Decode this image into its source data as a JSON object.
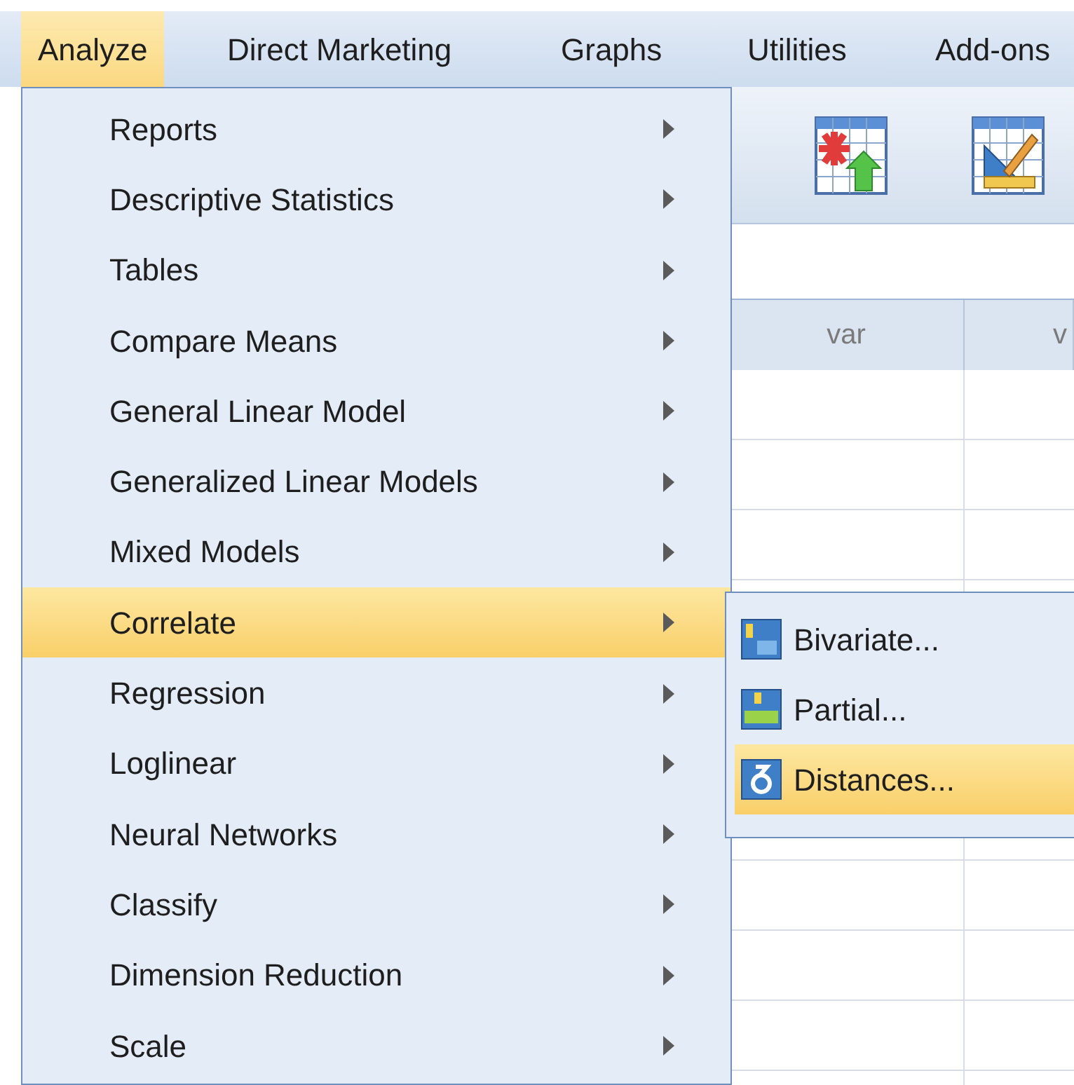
{
  "menu_bar": [
    {
      "label": "Analyze",
      "selected": true
    },
    {
      "label": "Direct Marketing",
      "selected": false
    },
    {
      "label": "Graphs",
      "selected": false
    },
    {
      "label": "Utilities",
      "selected": false
    },
    {
      "label": "Add-ons",
      "selected": false
    }
  ],
  "analyze_menu": {
    "items": [
      {
        "label": "Reports",
        "submenu": true,
        "selected": false
      },
      {
        "label": "Descriptive Statistics",
        "submenu": true,
        "selected": false
      },
      {
        "label": "Tables",
        "submenu": true,
        "selected": false
      },
      {
        "label": "Compare Means",
        "submenu": true,
        "selected": false
      },
      {
        "label": "General Linear Model",
        "submenu": true,
        "selected": false
      },
      {
        "label": "Generalized Linear Models",
        "submenu": true,
        "selected": false
      },
      {
        "label": "Mixed Models",
        "submenu": true,
        "selected": false
      },
      {
        "label": "Correlate",
        "submenu": true,
        "selected": true
      },
      {
        "label": "Regression",
        "submenu": true,
        "selected": false
      },
      {
        "label": "Loglinear",
        "submenu": true,
        "selected": false
      },
      {
        "label": "Neural Networks",
        "submenu": true,
        "selected": false
      },
      {
        "label": "Classify",
        "submenu": true,
        "selected": false
      },
      {
        "label": "Dimension Reduction",
        "submenu": true,
        "selected": false
      },
      {
        "label": "Scale",
        "submenu": true,
        "selected": false
      }
    ]
  },
  "correlate_submenu": {
    "items": [
      {
        "label": "Bivariate...",
        "kind": "bivariate",
        "selected": false
      },
      {
        "label": "Partial...",
        "kind": "partial",
        "selected": false
      },
      {
        "label": "Distances...",
        "kind": "distances",
        "selected": true
      }
    ]
  },
  "grid": {
    "columns": [
      "var",
      "v"
    ]
  }
}
